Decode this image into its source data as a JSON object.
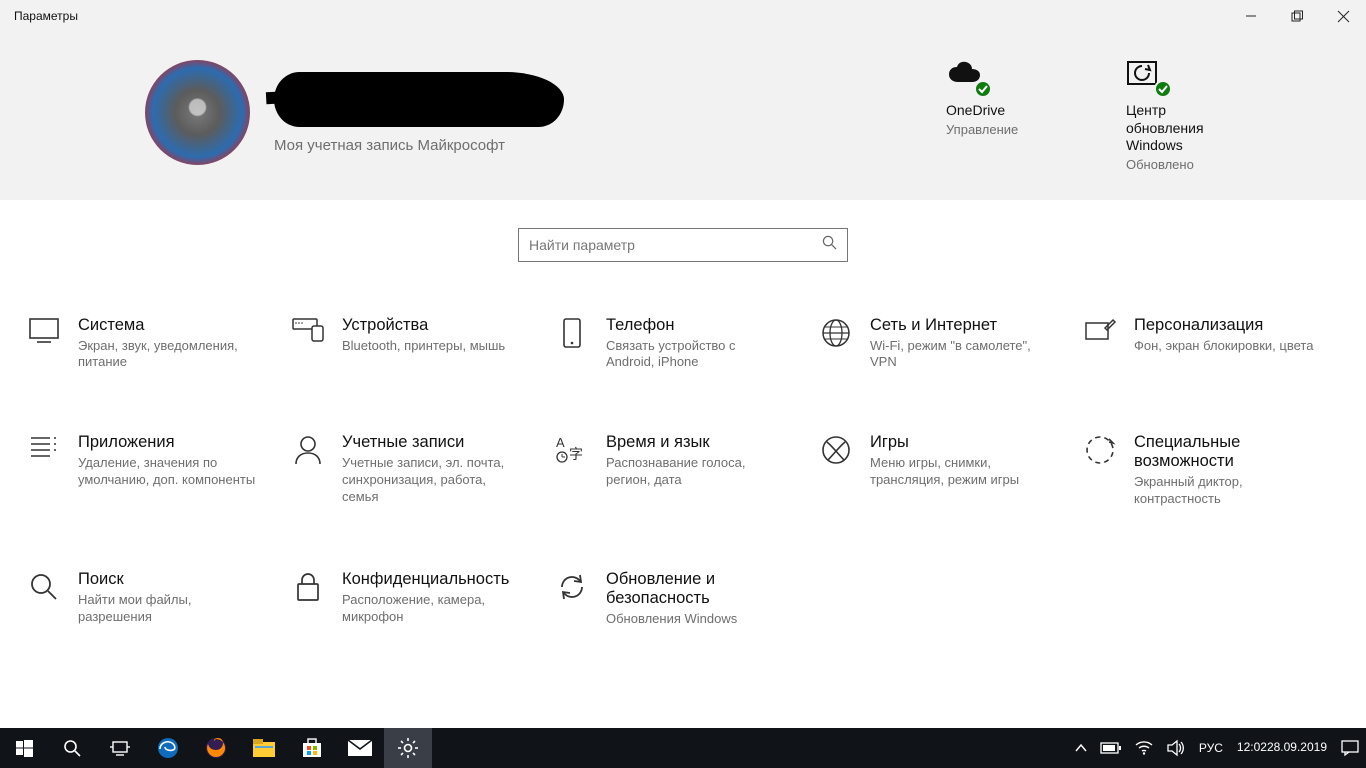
{
  "window": {
    "title": "Параметры"
  },
  "header": {
    "subtitle": "Моя учетная запись Майкрософт",
    "status": [
      {
        "title": "OneDrive",
        "sub": "Управление"
      },
      {
        "title": "Центр обновления Windows",
        "sub": "Обновлено"
      }
    ]
  },
  "search": {
    "placeholder": "Найти параметр"
  },
  "categories": [
    {
      "id": "system",
      "title": "Система",
      "desc": "Экран, звук, уведомления, питание"
    },
    {
      "id": "devices",
      "title": "Устройства",
      "desc": "Bluetooth, принтеры, мышь"
    },
    {
      "id": "phone",
      "title": "Телефон",
      "desc": "Связать устройство с Android, iPhone"
    },
    {
      "id": "network",
      "title": "Сеть и Интернет",
      "desc": "Wi-Fi, режим \"в самолете\", VPN"
    },
    {
      "id": "personalization",
      "title": "Персонализация",
      "desc": "Фон, экран блокировки, цвета"
    },
    {
      "id": "apps",
      "title": "Приложения",
      "desc": "Удаление, значения по умолчанию, доп. компоненты"
    },
    {
      "id": "accounts",
      "title": "Учетные записи",
      "desc": "Учетные записи, эл. почта, синхронизация, работа, семья"
    },
    {
      "id": "time",
      "title": "Время и язык",
      "desc": "Распознавание голоса, регион, дата"
    },
    {
      "id": "gaming",
      "title": "Игры",
      "desc": "Меню игры, снимки, трансляция, режим игры"
    },
    {
      "id": "ease",
      "title": "Специальные возможности",
      "desc": "Экранный диктор, контрастность"
    },
    {
      "id": "search",
      "title": "Поиск",
      "desc": "Найти мои файлы, разрешения"
    },
    {
      "id": "privacy",
      "title": "Конфиденциальность",
      "desc": "Расположение, камера, микрофон"
    },
    {
      "id": "update",
      "title": "Обновление и безопасность",
      "desc": "Обновления Windows"
    }
  ],
  "taskbar": {
    "lang": "РУС",
    "time": "12:02",
    "date": "28.09.2019"
  }
}
